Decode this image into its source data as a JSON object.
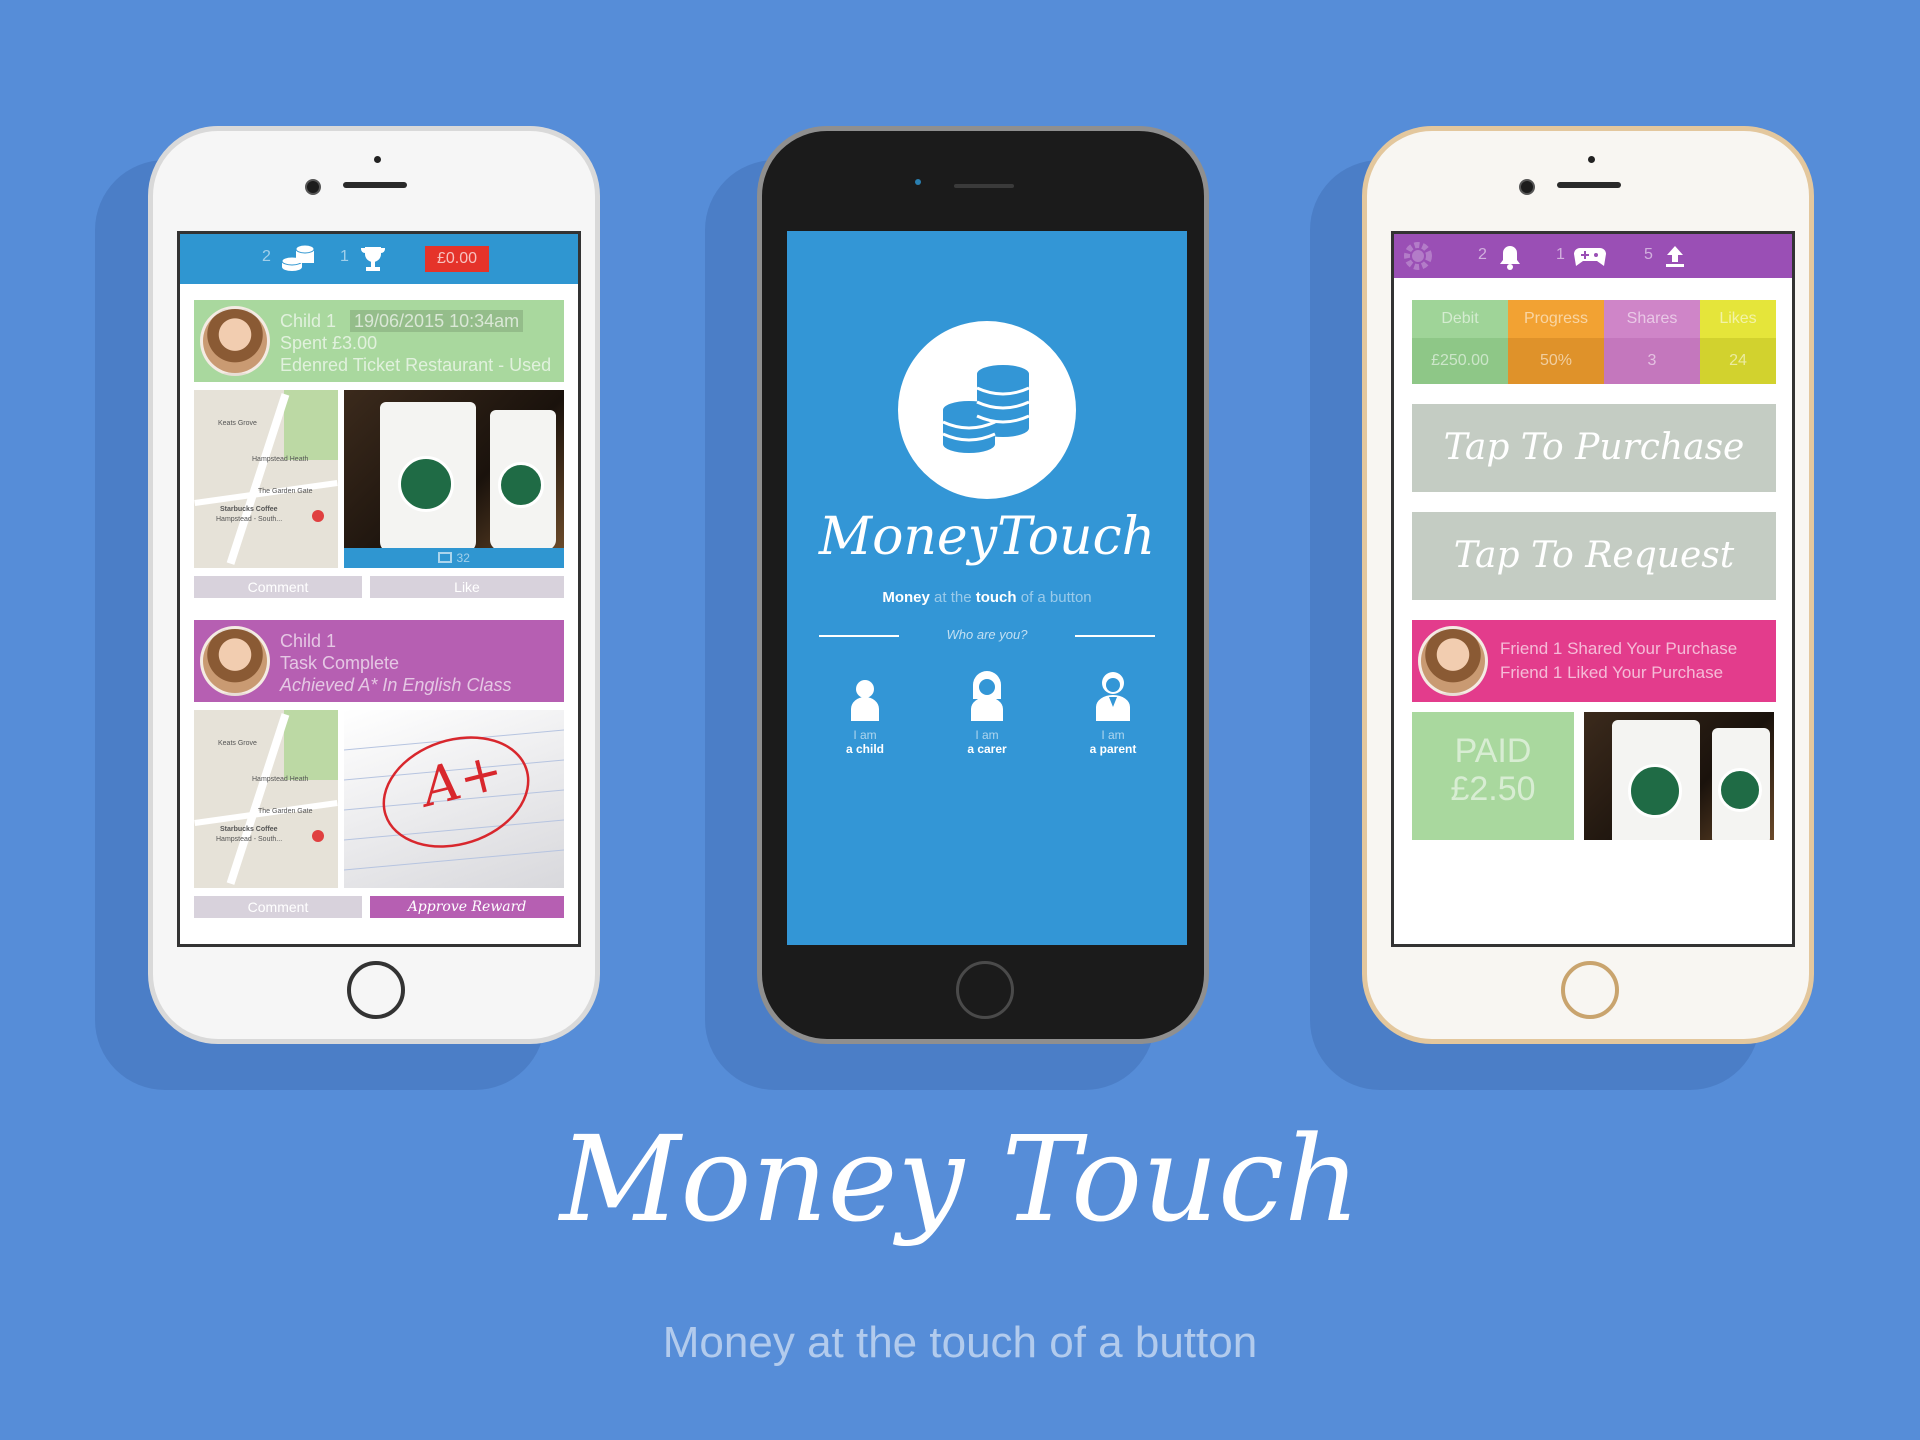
{
  "left_phone": {
    "header": {
      "coins_count": "2",
      "coins_icon": "coins-icon",
      "trophy_count": "1",
      "trophy_icon": "trophy-icon",
      "balance": "£0.00"
    },
    "card1": {
      "name": "Child 1",
      "timestamp": "19/06/2015 10:34am",
      "line2": "Spent £3.00",
      "line3": "Edenred Ticket Restaurant - Used",
      "photo_count": "32",
      "comment_label": "Comment",
      "like_label": "Like"
    },
    "card2": {
      "name": "Child 1",
      "line2": "Task Complete",
      "line3": "Achieved A* In English Class",
      "comment_label": "Comment",
      "approve_label": "Approve Reward"
    },
    "map": {
      "label_street": "Keats Grove",
      "label_heath": "Hampstead Heath",
      "label_garden": "The Garden Gate",
      "label_shop1": "Starbucks Coffee",
      "label_shop2": "Hampstead - South..."
    },
    "grade_text": "A+",
    "colors": {
      "header": "#2f96d1",
      "card1": "#a9d89e",
      "card2": "#b65fb2",
      "balance_badge": "#e5332a"
    }
  },
  "middle_phone": {
    "logo_icon": "coins-icon",
    "app_name": "MoneyTouch",
    "tagline_bold1": "Money",
    "tagline_mid": "at the",
    "tagline_bold2": "touch",
    "tagline_end": "of a button",
    "question": "Who are you?",
    "roles": [
      {
        "prefix": "I am",
        "label": "a child",
        "icon": "child-icon"
      },
      {
        "prefix": "I am",
        "label": "a carer",
        "icon": "carer-icon"
      },
      {
        "prefix": "I am",
        "label": "a parent",
        "icon": "parent-icon"
      }
    ],
    "colors": {
      "screen": "#3396d6"
    }
  },
  "right_phone": {
    "header": {
      "settings_icon": "gear-icon",
      "bell_count": "2",
      "bell_icon": "bell-icon",
      "game_count": "1",
      "game_icon": "gamepad-icon",
      "share_count": "5",
      "share_icon": "upload-icon"
    },
    "stats": [
      {
        "label": "Debit",
        "value": "£250.00",
        "color": "#9fd498"
      },
      {
        "label": "Progress",
        "value": "50%",
        "color": "#f2a233"
      },
      {
        "label": "Shares",
        "value": "3",
        "color": "#cf85c8"
      },
      {
        "label": "Likes",
        "value": "24",
        "color": "#e5e53a"
      }
    ],
    "purchase_label": "Tap To Purchase",
    "request_label": "Tap To Request",
    "notification": {
      "line1": "Friend 1 Shared Your Purchase",
      "line2": "Friend 1 Liked Your Purchase"
    },
    "paid_label": "PAID",
    "paid_amount": "£2.50",
    "colors": {
      "header": "#9a4fb5",
      "notification": "#e33c8c",
      "paid": "#a9d89e"
    }
  },
  "headline": "Money Touch",
  "subtitle": "Money at the touch of a button"
}
